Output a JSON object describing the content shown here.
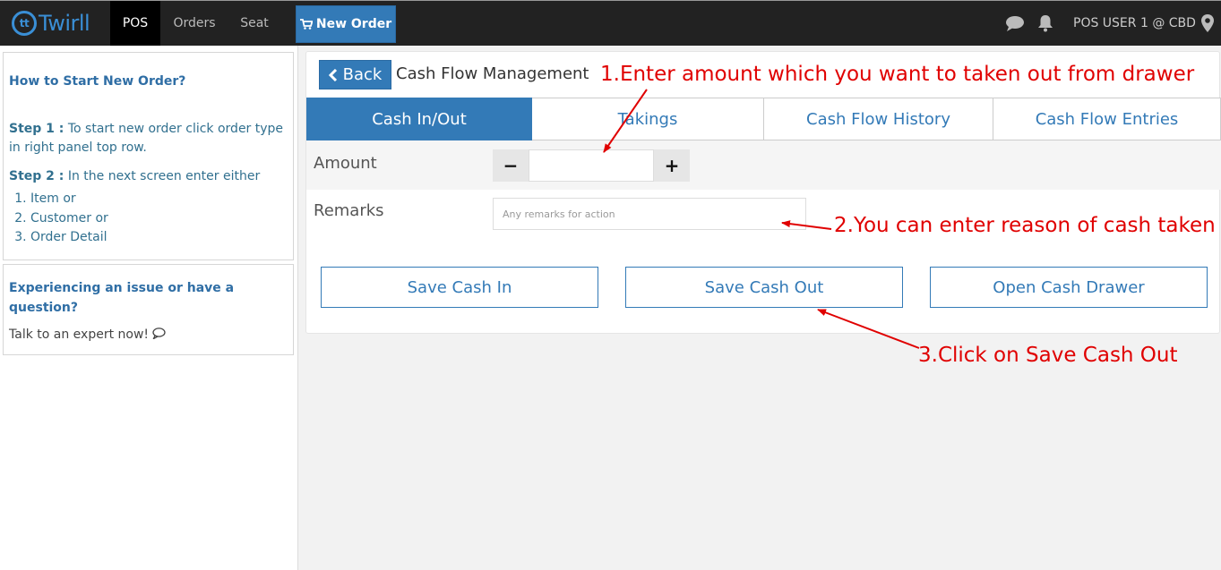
{
  "navbar": {
    "logo_text": "Twirll",
    "logo_mark": "tt",
    "items": [
      {
        "label": "POS",
        "active": true
      },
      {
        "label": "Orders",
        "active": false
      },
      {
        "label": "Seat",
        "active": false
      }
    ],
    "new_order_label": "New Order",
    "user_label": "POS USER 1 @ CBD",
    "icons": [
      "chat-icon",
      "bell-icon",
      "map-pin-icon",
      "cart-icon"
    ]
  },
  "help": {
    "title": "How to Start New Order?",
    "step1_label": "Step 1 :",
    "step1_text": " To start new order click order type in right panel top row.",
    "step2_label": "Step 2 :",
    "step2_text": " In the next screen enter either",
    "options": [
      "Item or",
      "Customer or",
      "Order Detail"
    ]
  },
  "support": {
    "title": "Experiencing an issue or have a question?",
    "talk_text": "Talk to an expert now!"
  },
  "main": {
    "back_label": "Back",
    "title": "Cash Flow Management",
    "tabs": [
      {
        "label": "Cash In/Out",
        "active": true
      },
      {
        "label": "Takings",
        "active": false
      },
      {
        "label": "Cash Flow History",
        "active": false
      },
      {
        "label": "Cash Flow Entries",
        "active": false
      }
    ],
    "amount_label": "Amount",
    "minus_label": "−",
    "plus_label": "+",
    "amount_value": "",
    "remarks_label": "Remarks",
    "remarks_placeholder": "Any remarks for action",
    "buttons": {
      "save_cash_in": "Save Cash In",
      "save_cash_out": "Save Cash Out",
      "open_cash_drawer": "Open Cash Drawer"
    }
  },
  "annotations": {
    "note1": "1.Enter amount which you want to taken out from drawer",
    "note2": "2.You can enter reason of cash taken",
    "note3": "3.Click on Save Cash Out",
    "color": "#e00000"
  },
  "colors": {
    "accent": "#337ab7",
    "navbar_bg": "#222222",
    "annotation": "#e00000"
  }
}
